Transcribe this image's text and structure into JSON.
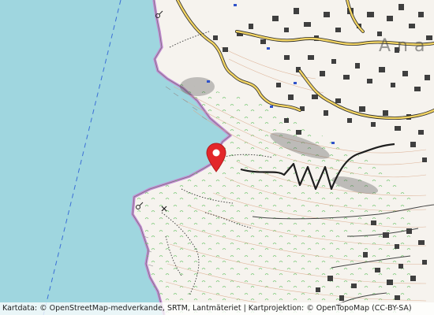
{
  "map": {
    "place_label": "Ana",
    "attribution": "Kartdata: © OpenStreetMap-medverkande, SRTM, Lantmäteriet | Kartprojektion: © OpenTopoMap (CC-BY-SA)",
    "colors": {
      "sea": "#9fd6df",
      "land": "#f6f3ee",
      "coast_border": "#c58ad6",
      "contour": "#d9a98a",
      "road_main": "#2a2a2a",
      "road_fill": "#f2d463",
      "building": "#3f3f3f",
      "vegetation_mark": "#6cc36a",
      "marker": "#e3262a"
    },
    "icons": [
      "map-pin-icon",
      "viewpoint-icon",
      "peak-cross-icon",
      "boundary-line"
    ]
  }
}
